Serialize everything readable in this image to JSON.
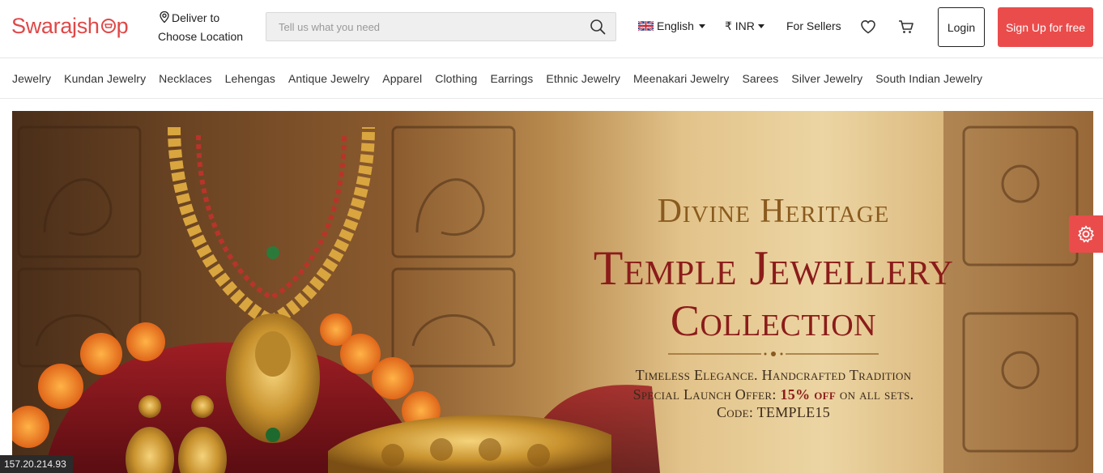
{
  "header": {
    "logo": {
      "text_left": "Swarajsh",
      "text_right": "p"
    },
    "deliver": {
      "line1": "Deliver to",
      "line2": "Choose Location"
    },
    "search": {
      "placeholder": "Tell us what you need",
      "value": ""
    },
    "language": "English",
    "currency": "₹ INR",
    "for_sellers": "For Sellers",
    "login_label": "Login",
    "signup_label": "Sign Up for free"
  },
  "categories": [
    "Jewelry",
    "Kundan Jewelry",
    "Necklaces",
    "Lehengas",
    "Antique Jewelry",
    "Apparel",
    "Clothing",
    "Earrings",
    "Ethnic Jewelry",
    "Meenakari Jewelry",
    "Sarees",
    "Silver Jewelry",
    "South Indian Jewelry"
  ],
  "banner": {
    "kicker": "Divine Heritage",
    "title_line1": "Temple Jewellery",
    "title_line2": "Collection",
    "line1": "Timeless Elegance. Handcrafted Tradition",
    "line2_prefix": "Special Launch Offer:",
    "line2_accent": "15% off",
    "line2_suffix": "on all sets.",
    "line3": "Code: TEMPLE15"
  },
  "ip_address": "157.20.214.93",
  "colors": {
    "brand_red": "#ea4c4c",
    "logo_red": "#e04848",
    "banner_title": "#8b1c1a"
  },
  "icons": [
    "location-pin-icon",
    "search-icon",
    "uk-flag-icon",
    "heart-icon",
    "cart-icon",
    "gear-icon"
  ]
}
